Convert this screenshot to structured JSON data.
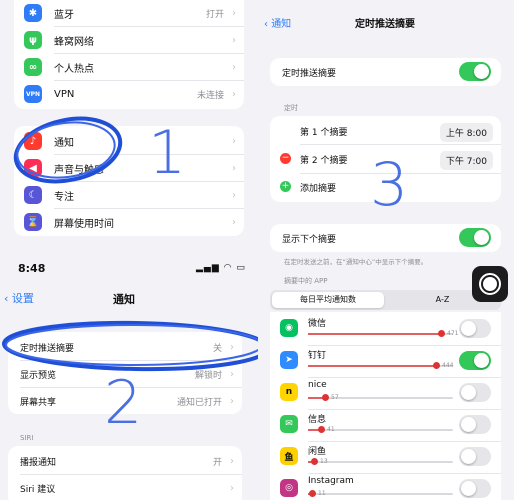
{
  "top_left": {
    "group1": [
      {
        "label": "蓝牙",
        "value": "打开",
        "icon": "bluetooth-icon",
        "color": "#2f7cf6"
      },
      {
        "label": "蜂窝网络",
        "value": "",
        "icon": "antenna-icon",
        "color": "#34c759"
      },
      {
        "label": "个人热点",
        "value": "",
        "icon": "hotspot-icon",
        "color": "#34c759"
      },
      {
        "label": "VPN",
        "value": "未连接",
        "icon": "vpn-icon",
        "color": "#2f7cf6"
      }
    ],
    "group2": [
      {
        "label": "通知",
        "icon": "bell-icon",
        "color": "#ff3b30"
      },
      {
        "label": "声音与触感",
        "icon": "speaker-icon",
        "color": "#ff2d55"
      },
      {
        "label": "专注",
        "icon": "moon-icon",
        "color": "#5856d6"
      },
      {
        "label": "屏幕使用时间",
        "icon": "hourglass-icon",
        "color": "#5856d6"
      }
    ],
    "annotation": "1"
  },
  "bottom_left": {
    "status_time": "8:48",
    "back_label": "设置",
    "title": "通知",
    "group1": [
      {
        "label": "定时推送摘要",
        "value": "关"
      },
      {
        "label": "显示预览",
        "value": "解锁时"
      },
      {
        "label": "屏幕共享",
        "value": "通知已打开"
      }
    ],
    "siri_header": "SIRI",
    "group2": [
      {
        "label": "播报通知",
        "value": "开"
      },
      {
        "label": "Siri 建议",
        "value": ""
      }
    ],
    "annotation": "2"
  },
  "right": {
    "back_label": "通知",
    "title": "定时推送摘要",
    "summary_toggle_label": "定时推送摘要",
    "summary_toggle_on": true,
    "schedule_header": "定时",
    "schedule": [
      {
        "label": "第 1 个摘要",
        "time": "上午 8:00"
      },
      {
        "label": "第 2 个摘要",
        "time": "下午 7:00"
      }
    ],
    "add_summary_label": "添加摘要",
    "next_summary_label": "显示下个摘要",
    "next_summary_on": true,
    "next_summary_note": "在定时发送之前，在“通知中心”中显示下个摘要。",
    "apps_header": "摘要中的 APP",
    "segments": [
      "每日平均通知数",
      "A-Z"
    ],
    "apps": [
      {
        "name": "微信",
        "count": "471",
        "level": 0.92,
        "on": false,
        "icon": "wechat-icon",
        "color": "#07c160",
        "glyph": "◉"
      },
      {
        "name": "钉钉",
        "count": "444",
        "level": 0.88,
        "on": true,
        "icon": "dingtalk-icon",
        "color": "#2f8cff",
        "glyph": "➤"
      },
      {
        "name": "nice",
        "count": "57",
        "level": 0.12,
        "on": false,
        "icon": "nice-icon",
        "color": "#ffd400",
        "glyph": "n"
      },
      {
        "name": "信息",
        "count": "41",
        "level": 0.09,
        "on": false,
        "icon": "messages-icon",
        "color": "#34c759",
        "glyph": "✉"
      },
      {
        "name": "闲鱼",
        "count": "13",
        "level": 0.04,
        "on": false,
        "icon": "xianyu-icon",
        "color": "#ffd000",
        "glyph": "鱼"
      },
      {
        "name": "Instagram",
        "count": "11",
        "level": 0.03,
        "on": false,
        "icon": "instagram-icon",
        "color": "#c13584",
        "glyph": "◎"
      }
    ],
    "annotation": "3"
  }
}
